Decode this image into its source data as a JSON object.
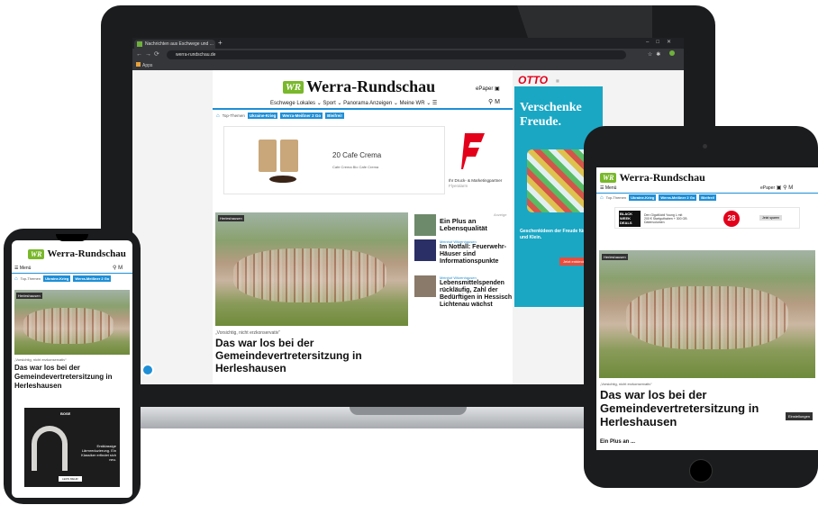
{
  "browser": {
    "tab_title": "Nachrichten aus Eschwege und ...",
    "url": "werra-rundschau.de",
    "bookmark": "Apps"
  },
  "site": {
    "logo_badge": "WR",
    "logo_text": "Werra-Rundschau",
    "epaper": "ePaper",
    "nav": [
      "Eschwege",
      "Lokales ⌄",
      "Sport ⌄",
      "Panorama",
      "Anzeigen ⌄",
      "Meine WR ⌄"
    ],
    "topics_label": "Top-Themen",
    "topics": [
      "Ukraine-Krieg",
      "Werra-Meißner 2 Go",
      "Bleifrei!"
    ],
    "menu_label": "Menü"
  },
  "ad_coffee": {
    "title": "20 Cafe Crema",
    "subtitle": "Cafe Crema Bio Cafe Crema",
    "advertiser": "Ihr Druck- & Marketingpartner",
    "advertiser_sub": "Flyeralarm"
  },
  "hero": {
    "label": "Herleshausen",
    "kicker": "„Vorsichtig, nicht erzkonservativ“",
    "headline": "Das war los bei der Gemeindevertretersitzung in Herleshausen"
  },
  "side_articles": [
    {
      "kicker": "",
      "headline": "Ein Plus an Lebensqualität"
    },
    {
      "kicker": "Meinhof Witzenhausen",
      "headline": "Im Notfall: Feuerwehr-Häuser sind Informationspunkte"
    },
    {
      "kicker": "Meinhof Witzenhausen",
      "headline": "Lebensmittelspenden rückläufig, Zahl der Bedürftigen in Hessisch Lichtenau wächst"
    }
  ],
  "anzeige": "Anzeige",
  "ad_otto": {
    "brand": "OTTO",
    "title": "Verschenke Freude.",
    "body": "Geschenkideen der Freude für Groß und Klein.",
    "cta": "Jetzt entdecken"
  },
  "tablet_ad": {
    "badge": "BLACK WEEK DEALS",
    "text": "Den GigaMobil Young L mit 200 € Startguthaben + 300 GB Datenvolumen",
    "number": "28",
    "cta": "Jetzt sparen"
  },
  "tablet": {
    "button": "Einstellungen",
    "bottom_headline": "Ein Plus an ..."
  },
  "phone_ad": {
    "brand": "BOSE",
    "text": "Erstklassige Lärmreduzierung. Ein Klassiker erfindet sich neu.",
    "cta": "LERN MEHR"
  }
}
